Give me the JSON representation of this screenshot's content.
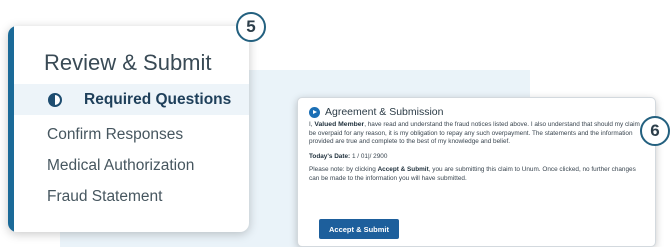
{
  "nav": {
    "heading": "Review & Submit",
    "items": [
      {
        "label": "Required Questions",
        "icon": "half-circle-icon",
        "active": true
      },
      {
        "label": "Confirm Responses"
      },
      {
        "label": "Medical Authorization"
      },
      {
        "label": "Fraud Statement"
      }
    ]
  },
  "badges": {
    "step5": "5",
    "step6": "6"
  },
  "agreement": {
    "title": "Agreement & Submission",
    "body_prefix": "I, ",
    "member_name": "Valued Member",
    "body_text": ", have read and understand the fraud notices listed above. I also understand that should my claim be overpaid for any reason, it is my obligation to repay any such overpayment. The statements and the information provided are true and complete to the best of my knowledge and belief.",
    "date_label": "Today's Date:",
    "date_value": "1 / 01|/ 2900",
    "note_prefix": "Please note: by clicking ",
    "note_action": "Accept & Submit",
    "note_text": ", you are submitting this claim to Unum. Once clicked, no further changes can be made to the information you will have submitted.",
    "submit_label": "Accept & Submit"
  },
  "colors": {
    "accent": "#1b6a98",
    "button": "#1d5f9c",
    "backdrop": "#eaf3f9"
  }
}
